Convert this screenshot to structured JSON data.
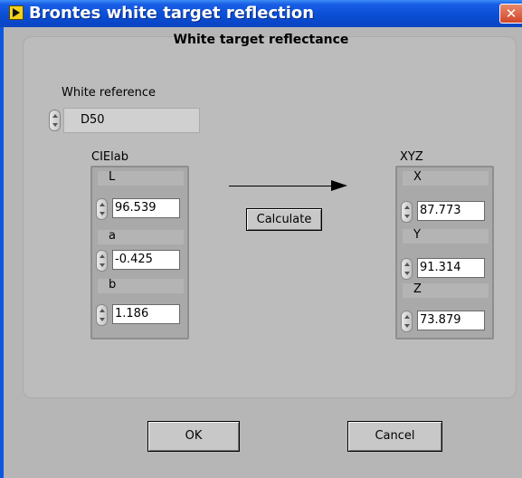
{
  "window": {
    "title": "Brontes white target reflection",
    "close_glyph": "✕"
  },
  "panel": {
    "title": "White target reflectance"
  },
  "white_reference": {
    "label": "White reference",
    "value": "D50"
  },
  "cielab": {
    "label": "CIElab",
    "fields": [
      {
        "label": "L",
        "value": "96.539"
      },
      {
        "label": "a",
        "value": "-0.425"
      },
      {
        "label": "b",
        "value": "1.186"
      }
    ]
  },
  "xyz": {
    "label": "XYZ",
    "fields": [
      {
        "label": "X",
        "value": "87.773"
      },
      {
        "label": "Y",
        "value": "91.314"
      },
      {
        "label": "Z",
        "value": "73.879"
      }
    ]
  },
  "buttons": {
    "calculate": "Calculate",
    "ok": "OK",
    "cancel": "Cancel"
  },
  "icons": {
    "app": "labview-vi-icon",
    "arrow": "right-arrow-icon",
    "spin": "increment-decrement-icon"
  }
}
